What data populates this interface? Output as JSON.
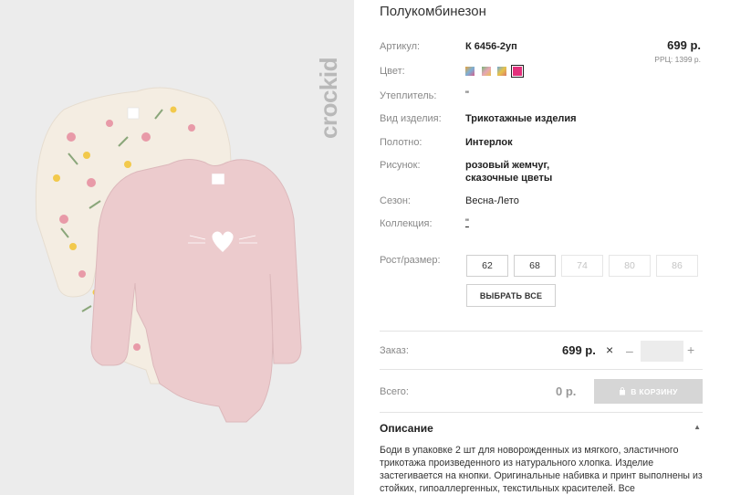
{
  "product": {
    "title": "Полукомбинезон",
    "brand": "crockid"
  },
  "attributes": [
    {
      "label": "Артикул:",
      "value": "К 6456-2уп",
      "bold": true
    },
    {
      "label": "Цвет:",
      "value": "",
      "bold": false
    },
    {
      "label": "Утеплитель:",
      "value": "\"",
      "bold": false
    },
    {
      "label": "Вид изделия:",
      "value": "Трикотажные изделия",
      "bold": true
    },
    {
      "label": "Полотно:",
      "value": "Интерлок",
      "bold": true
    },
    {
      "label": "Рисунок:",
      "value": "розовый жемчуг,",
      "value2": "сказочные цветы",
      "bold": true
    },
    {
      "label": "Сезон:",
      "value": "Весна-Лето",
      "bold": false
    },
    {
      "label": "Коллекция:",
      "value": "\"",
      "bold": false
    }
  ],
  "pricing": {
    "price": "699 р.",
    "rrp": "РРЦ: 1399 р."
  },
  "colors": {
    "swatches": [
      {
        "name": "multicolor-swatch-1",
        "selected": false
      },
      {
        "name": "multicolor-swatch-2",
        "selected": false
      },
      {
        "name": "multicolor-swatch-3",
        "selected": false
      },
      {
        "name": "pink-swatch",
        "selected": true,
        "color": "#e3317c"
      }
    ]
  },
  "sizes": {
    "label": "Рост/размер:",
    "options": [
      {
        "label": "62",
        "available": true
      },
      {
        "label": "68",
        "available": true
      },
      {
        "label": "74",
        "available": false
      },
      {
        "label": "80",
        "available": false
      },
      {
        "label": "86",
        "available": false
      }
    ],
    "select_all": "ВЫБРАТЬ ВСЕ"
  },
  "order": {
    "label": "Заказ:",
    "price": "699 р.",
    "times_icon": "×",
    "minus": "–",
    "plus": "+",
    "quantity": ""
  },
  "total": {
    "label": "Всего:",
    "value": "0 р.",
    "cart_button": "В КОРЗИНУ",
    "cart_icon": "bag-icon"
  },
  "description": {
    "title": "Описание",
    "caret": "▲",
    "text": "Боди в упаковке 2 шт для новорожденных из мягкого, эластичного трикотажа произведенного из натурального хлопка. Изделие застегивается на кнопки. Оригинальные набивка и принт выполнены из стойких, гипоаллергенных, текстильных красителей. Все"
  },
  "theme": {
    "accent": "#e3317c",
    "cart_button_bg": "#d6d6d6",
    "photo_bg": "#ececec"
  }
}
